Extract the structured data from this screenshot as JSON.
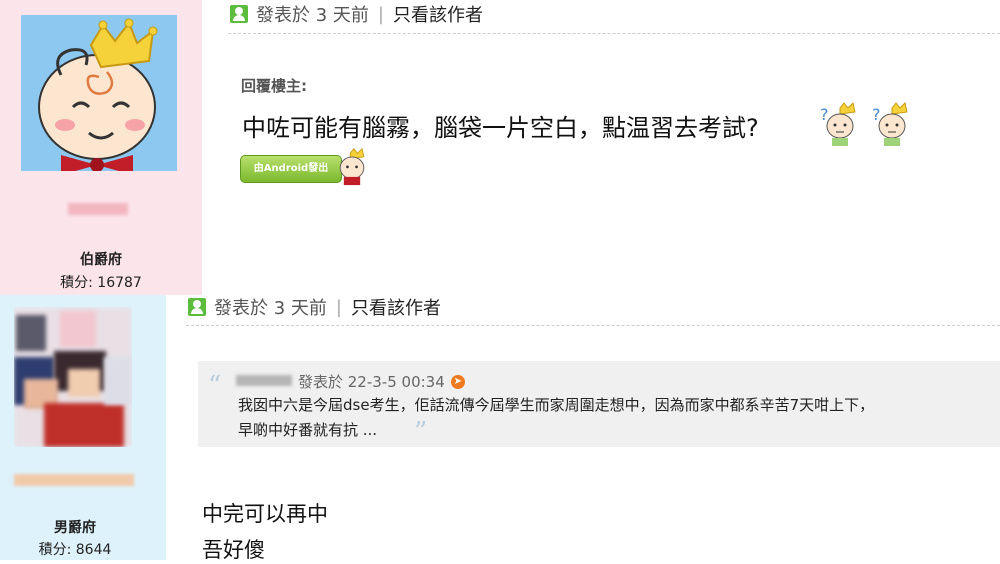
{
  "post1": {
    "user": {
      "rank": "伯爵府",
      "score": "積分: 16787"
    },
    "header": {
      "posted": "發表於 3 天前",
      "separator": "|",
      "only_author": "只看該作者"
    },
    "reply_label": "回覆樓主:",
    "content": "中咗可能有腦霧，腦袋一片空白，點温習去考試?",
    "badge": "由Android發出"
  },
  "post2": {
    "user": {
      "rank": "男爵府",
      "score": "積分: 8644"
    },
    "header": {
      "posted": "發表於 3 天前",
      "separator": "|",
      "only_author": "只看該作者"
    },
    "quote": {
      "meta": "發表於 22-3-5 00:34",
      "line1": "我囡中六是今屆dse考生，佢話流傳今屆學生而家周圍走想中，因為而家中都系辛苦7天咁上下，",
      "line2": "早啲中好番就有抗 ..."
    },
    "content": [
      "中完可以再中",
      "吾好傻"
    ]
  },
  "icons": [
    "user-icon",
    "quote-open-icon",
    "quote-close-icon",
    "jump-to-post-icon",
    "thinking-baby-emoticon"
  ],
  "colors": {
    "post1_sidebar": "#fbe4ea",
    "post2_sidebar": "#def2fb",
    "quote_bg": "#f0f0f0",
    "icon_green": "#5cbc3c"
  }
}
